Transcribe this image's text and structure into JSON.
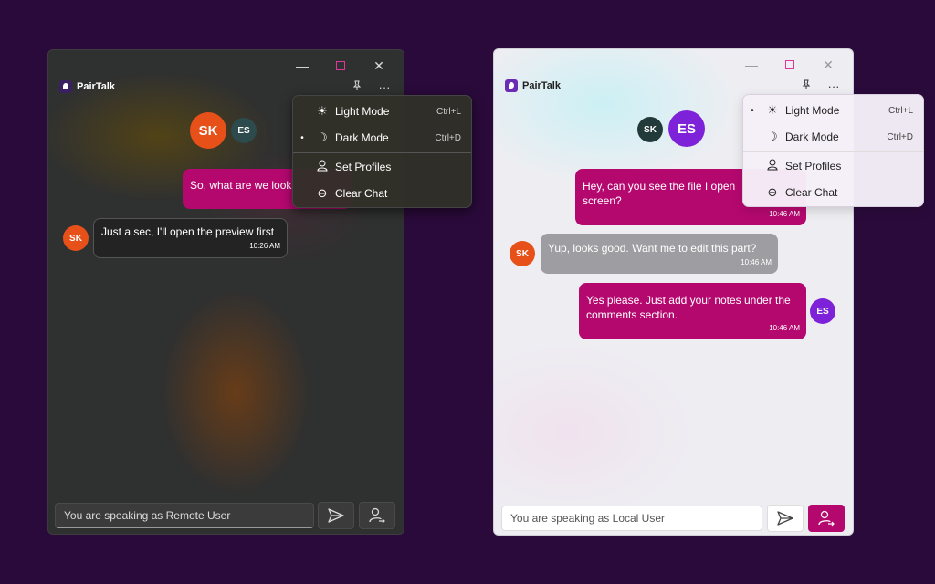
{
  "app_name": "PairTalk",
  "caption": {
    "minimize": "—",
    "close": "✕"
  },
  "toolbar": {
    "pin_icon": "pin-icon",
    "more_label": "···"
  },
  "menu": {
    "items": [
      {
        "label": "Light Mode",
        "shortcut": "Ctrl+L",
        "icon": "sun-icon"
      },
      {
        "label": "Dark Mode",
        "shortcut": "Ctrl+D",
        "icon": "moon-icon"
      },
      {
        "label": "Set Profiles",
        "icon": "person-icon"
      },
      {
        "label": "Clear Chat",
        "icon": "minus-circle-icon"
      }
    ],
    "dot": "•"
  },
  "remote_window": {
    "avatars": {
      "primary": "SK",
      "secondary": "ES"
    },
    "messages": [
      {
        "from": "ES",
        "text": "So, what are we look",
        "time": ""
      },
      {
        "from": "SK",
        "text": "Just a sec, I'll open the preview first",
        "time": "10:26 AM"
      }
    ],
    "input_placeholder": "You are speaking as Remote User",
    "selected_mode": "Dark Mode"
  },
  "local_window": {
    "avatars": {
      "primary": "ES",
      "secondary": "SK"
    },
    "messages": [
      {
        "from": "ES",
        "text_line1": "Hey, can you see the file I open",
        "text_line2": "screen?",
        "time": "10:46 AM"
      },
      {
        "from": "SK",
        "text": "Yup, looks good. Want me to edit this part?",
        "time": "10:46 AM"
      },
      {
        "from": "ES",
        "text_line1": "Yes please. Just add your notes under the",
        "text_line2": "comments section.",
        "time": "10:46 AM"
      }
    ],
    "input_placeholder": "You are speaking as Local User",
    "selected_mode": "Light Mode"
  },
  "colors": {
    "background": "#2a0a3a",
    "accent_pink": "#b5086f",
    "avatar_sk": "#e8501a",
    "avatar_es": "#7d22d8",
    "avatar_es_dark": "#2d4a4c",
    "avatar_sk_dark": "#233a3a"
  }
}
